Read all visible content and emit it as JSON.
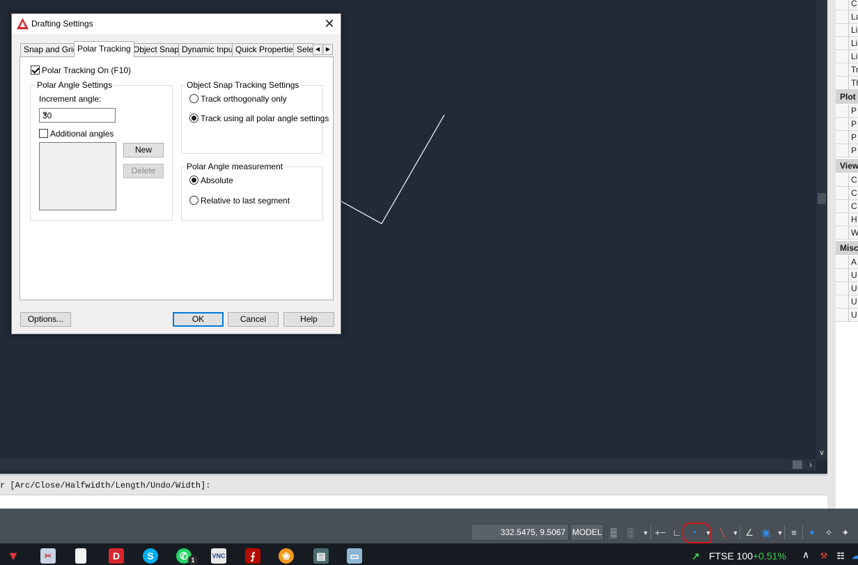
{
  "dialog": {
    "title": "Drafting Settings",
    "tabs": [
      {
        "label": "Snap and Grid"
      },
      {
        "label": "Polar Tracking"
      },
      {
        "label": "Object Snap"
      },
      {
        "label": "Dynamic Input"
      },
      {
        "label": "Quick Properties"
      },
      {
        "label": "Sele"
      }
    ],
    "active_tab": "Polar Tracking",
    "polar_tracking_on": {
      "label": "Polar Tracking On (F10)",
      "checked": true
    },
    "polar_angle_settings": {
      "title": "Polar Angle Settings",
      "increment_label": "Increment angle:",
      "increment_value": "30",
      "additional_angles": {
        "label": "Additional angles",
        "checked": false
      },
      "new_label": "New",
      "delete_label": "Delete"
    },
    "object_snap_tracking": {
      "title": "Object Snap Tracking Settings",
      "options": [
        "Track orthogonally only",
        "Track using all polar angle settings"
      ],
      "selected": "Track using all polar angle settings"
    },
    "polar_angle_measurement": {
      "title": "Polar Angle measurement",
      "options": [
        "Absolute",
        "Relative to last segment"
      ],
      "selected": "Absolute"
    },
    "buttons": {
      "options": "Options...",
      "ok": "OK",
      "cancel": "Cancel",
      "help": "Help"
    }
  },
  "command_line": {
    "history": "r [Arc/Close/Halfwidth/Length/Undo/Width]:"
  },
  "status_bar": {
    "coordinates": "332.5475, 9.5067",
    "model": "MODEL",
    "annotation_color": "#d8181a"
  },
  "palette": {
    "rows_a": [
      "C",
      "La",
      "Li",
      "Li",
      "Li",
      "Tr",
      "Th"
    ],
    "category_plot": "Plot",
    "rows_plot": [
      "P",
      "P",
      "P",
      "P"
    ],
    "category_view": "View",
    "rows_view": [
      "C",
      "C",
      "C",
      "H",
      "W"
    ],
    "category_misc": "Misc",
    "rows_misc": [
      "A",
      "U",
      "U",
      "U",
      "U"
    ]
  },
  "taskbar": {
    "ticker": "FTSE 100",
    "change": "+0.51%",
    "change_color": "#3fd24a",
    "whatsapp_badge": "1"
  },
  "theme": {
    "canvas_bg": "#212a35",
    "accent": "#0078d7"
  }
}
